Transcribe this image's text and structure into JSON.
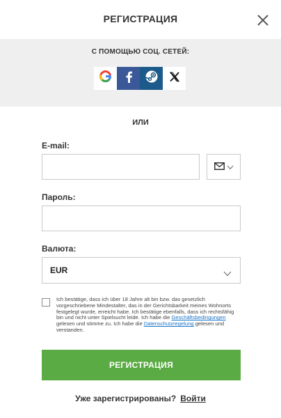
{
  "header": {
    "title": "РЕГИСТРАЦИЯ",
    "close_icon": "close-icon"
  },
  "social": {
    "label": "С ПОМОЩЬЮ СОЦ. СЕТЕЙ:",
    "buttons": [
      {
        "icon": "google-icon",
        "color": "#ffffff"
      },
      {
        "icon": "facebook-icon",
        "color": "#3b5998"
      },
      {
        "icon": "steam-icon",
        "color": "#1b5a8a"
      },
      {
        "icon": "x-icon",
        "color": "#ffffff"
      }
    ]
  },
  "divider": {
    "or_label": "ИЛИ"
  },
  "form": {
    "email": {
      "label": "E-mail:",
      "value": "",
      "placeholder": ""
    },
    "contact_type": {
      "icon": "envelope-icon"
    },
    "password": {
      "label": "Пароль:",
      "value": "",
      "placeholder": ""
    },
    "currency": {
      "label": "Валюта:",
      "value": "EUR"
    },
    "consent": {
      "checked": false,
      "text_1": "Ich bestätige, dass ich über 18 Jahre alt bin bzw. das gesetzlich vorgeschriebene Mindestalter, das in der Gerichtsbarkeit meines Wohnorts festgelegt wurde, erreicht habe. Ich bestätige ebenfalls, dass ich rechtsfähig bin und nicht unter Spielsucht leide. Ich habe die ",
      "link_1": "Geschäftsbedingungen",
      "text_2": " gelesen und stimme zu. Ich habe die ",
      "link_2": "Datenschutzregelung",
      "text_3": " gelesen und verstanden."
    },
    "submit_label": "РЕГИСТРАЦИЯ"
  },
  "footer": {
    "question": "Уже зарегистрированы?",
    "login_link": "Войти"
  },
  "colors": {
    "accent_green": "#5bab44",
    "link_blue": "#1a73c8",
    "panel_gray": "#efefef"
  }
}
